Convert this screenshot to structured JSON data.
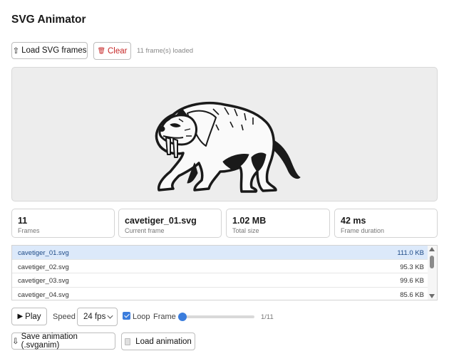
{
  "app": {
    "title": "SVG Animator"
  },
  "toolbar": {
    "load_icon": "⇧",
    "load_label": "Load SVG frames",
    "clear_icon": "🗑",
    "clear_label": "Clear",
    "loaded_status": "11 frame(s) loaded"
  },
  "preview": {
    "image": "cave-tiger-illustration",
    "background": "#ededed"
  },
  "stats": {
    "frames": {
      "value": "11",
      "label": "Frames"
    },
    "current": {
      "value": "cavetiger_01.svg",
      "label": "Current frame"
    },
    "size": {
      "value": "1.02 MB",
      "label": "Total size"
    },
    "duration": {
      "value": "42 ms",
      "label": "Frame duration"
    }
  },
  "files": [
    {
      "name": "cavetiger_01.svg",
      "size": "111.0 KB",
      "selected": true
    },
    {
      "name": "cavetiger_02.svg",
      "size": "95.3 KB"
    },
    {
      "name": "cavetiger_03.svg",
      "size": "99.6 KB"
    },
    {
      "name": "cavetiger_04.svg",
      "size": "85.6 KB"
    }
  ],
  "controls": {
    "play_icon": "▶",
    "play_label": "Play",
    "speed_label": "Speed",
    "speed_value": "24 fps",
    "loop_label": "Loop",
    "loop_checked": true,
    "frame_label": "Frame",
    "frame_position": 0,
    "frame_count": "1/11"
  },
  "footer": {
    "save_icon": "⇩",
    "save_label": "Save animation (.svganim)",
    "load_anim_label": "Load animation"
  },
  "colors": {
    "accent": "#3b7ddd",
    "clear": "#c62828",
    "selected_row": "#dce9fa"
  }
}
